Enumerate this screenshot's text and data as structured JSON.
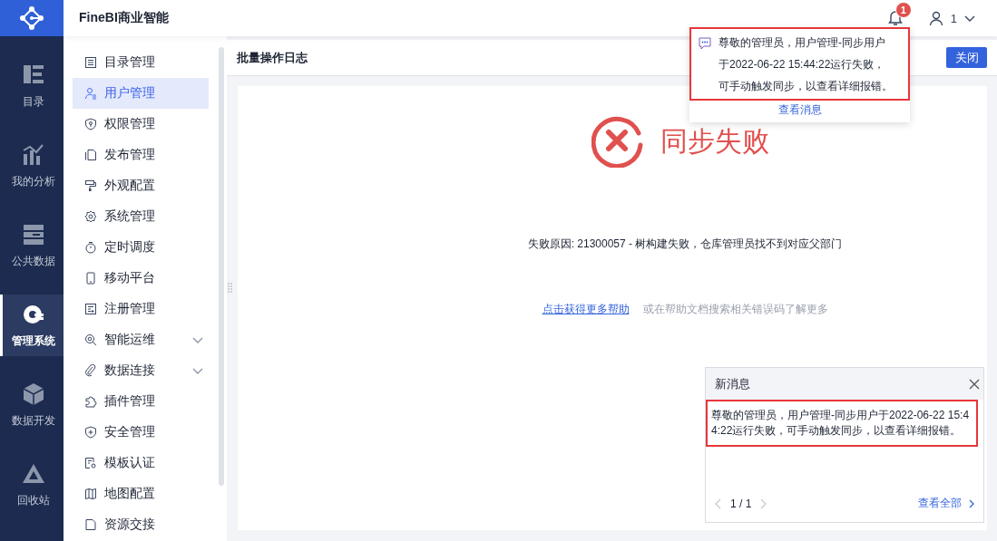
{
  "header": {
    "title": "FineBI商业智能",
    "notification_count": "1",
    "user": "1"
  },
  "rail": [
    {
      "label": "目录",
      "selected": false
    },
    {
      "label": "我的分析",
      "selected": false
    },
    {
      "label": "公共数据",
      "selected": false
    },
    {
      "label": "管理系统",
      "selected": true
    },
    {
      "label": "数据开发",
      "selected": false
    },
    {
      "label": "回收站",
      "selected": false
    }
  ],
  "sidebar": {
    "items": [
      {
        "label": "目录管理",
        "kind": "page",
        "selected": false
      },
      {
        "label": "用户管理",
        "kind": "page",
        "selected": true
      },
      {
        "label": "权限管理",
        "kind": "page",
        "selected": false
      },
      {
        "label": "发布管理",
        "kind": "page",
        "selected": false
      },
      {
        "label": "外观配置",
        "kind": "page",
        "selected": false
      },
      {
        "label": "系统管理",
        "kind": "page",
        "selected": false
      },
      {
        "label": "定时调度",
        "kind": "page",
        "selected": false
      },
      {
        "label": "移动平台",
        "kind": "page",
        "selected": false
      },
      {
        "label": "注册管理",
        "kind": "page",
        "selected": false
      },
      {
        "label": "智能运维",
        "kind": "group",
        "expanded": false,
        "selected": false
      },
      {
        "label": "数据连接",
        "kind": "group",
        "expanded": false,
        "selected": false
      },
      {
        "label": "插件管理",
        "kind": "page",
        "selected": false
      },
      {
        "label": "安全管理",
        "kind": "page",
        "selected": false
      },
      {
        "label": "模板认证",
        "kind": "page",
        "selected": false
      },
      {
        "label": "地图配置",
        "kind": "page",
        "selected": false
      },
      {
        "label": "资源交接",
        "kind": "page",
        "selected": false
      }
    ]
  },
  "main": {
    "title": "批量操作日志",
    "close_button": "关闭",
    "status": "同步失败",
    "reason": "失败原因: 21300057 - 树构建失败，仓库管理员找不到对应父部门",
    "help_link": "点击获得更多帮助",
    "help_hint": "或在帮助文档搜索相关错误码了解更多"
  },
  "notification_popup": {
    "highlighted": true,
    "lines": [
      "尊敬的管理员，用户管理-同步用户",
      "于2022-06-22 15:44:22运行失败，",
      "可手动触发同步，以查看详细报错。"
    ],
    "link": "查看消息"
  },
  "new_message_panel": {
    "title": "新消息",
    "highlighted": true,
    "message": "尊敬的管理员，用户管理-同步用户于2022-06-22 15:44:22运行失败，可手动触发同步，以查看详细报错。",
    "pager": "1 / 1",
    "view_all": "查看全部"
  }
}
